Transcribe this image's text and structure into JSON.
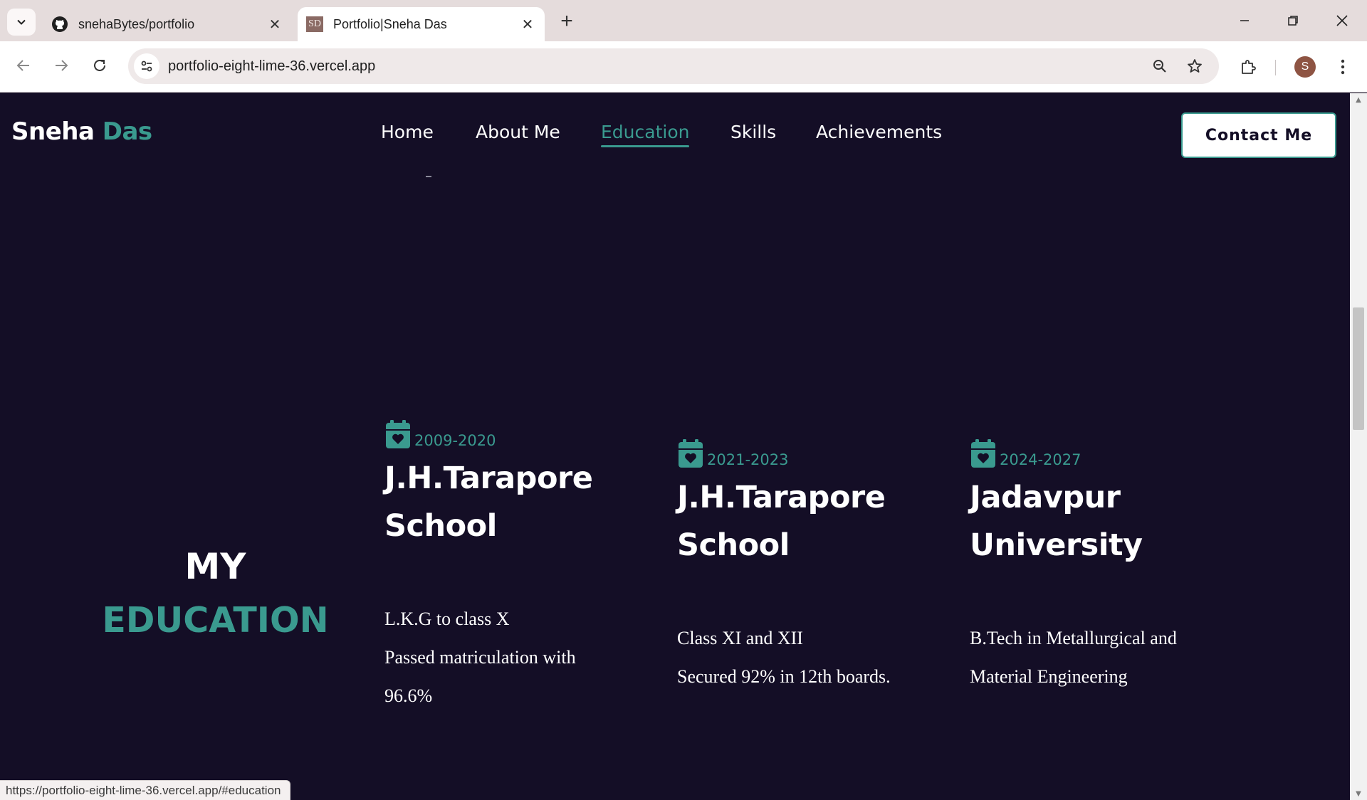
{
  "browser": {
    "tabs": [
      {
        "title": "snehaBytes/portfolio",
        "favicon": "github-icon"
      },
      {
        "title": "Portfolio|Sneha Das",
        "favicon_text": "SD"
      }
    ],
    "url": "portfolio-eight-lime-36.vercel.app",
    "profile_initial": "S",
    "status_url": "https://portfolio-eight-lime-36.vercel.app/#education"
  },
  "site": {
    "brand_first": "Sneha",
    "brand_last": "Das",
    "nav": [
      "Home",
      "About Me",
      "Education",
      "Skills",
      "Achievements"
    ],
    "active_nav": "Education",
    "contact_label": "Contact Me",
    "accent_color": "#3a9a8f",
    "background_color": "#140e26"
  },
  "education": {
    "heading_line1": "MY",
    "heading_line2": "EDUCATION",
    "entries": [
      {
        "years": "2009-2020",
        "school": "J.H.Tarapore School",
        "lines": [
          "L.K.G to class X",
          "Passed matriculation with",
          "96.6%"
        ]
      },
      {
        "years": "2021-2023",
        "school": "J.H.Tarapore School",
        "lines": [
          "Class XI and XII",
          "Secured 92% in 12th boards."
        ]
      },
      {
        "years": "2024-2027",
        "school": "Jadavpur University",
        "lines": [
          "B.Tech in Metallurgical and",
          "Material Engineering"
        ]
      }
    ]
  }
}
